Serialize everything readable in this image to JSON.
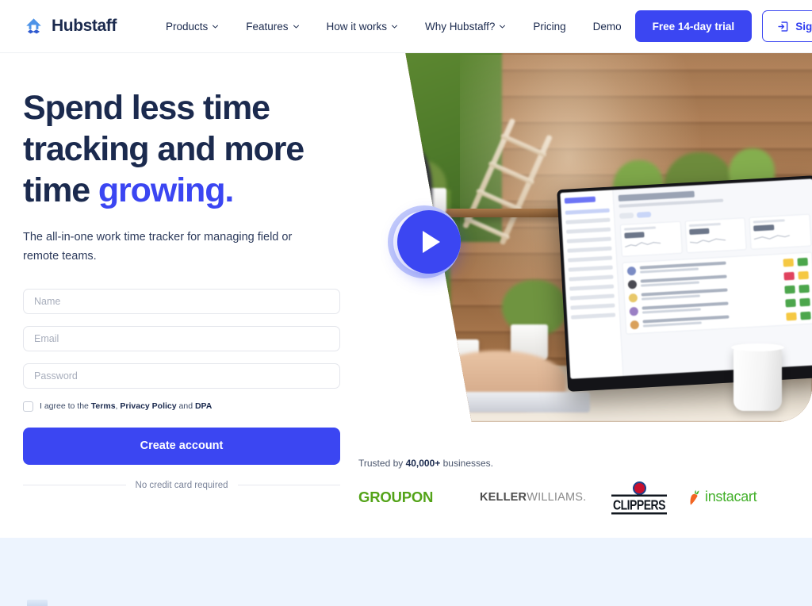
{
  "brand": {
    "name": "Hubstaff",
    "logo_icon": "hubstaff-logo-icon"
  },
  "colors": {
    "primary_blue": "#3b46f2",
    "headline_navy": "#1b2a4e",
    "groupon_green": "#53a318",
    "instacart_green": "#43b02a",
    "carrot_orange": "#f26522",
    "band_background": "#edf4fe"
  },
  "nav": {
    "items": [
      {
        "label": "Products",
        "has_dropdown": true,
        "icon": "chevron-down-icon"
      },
      {
        "label": "Features",
        "has_dropdown": true,
        "icon": "chevron-down-icon"
      },
      {
        "label": "How it works",
        "has_dropdown": true,
        "icon": "chevron-down-icon"
      },
      {
        "label": "Why Hubstaff?",
        "has_dropdown": true,
        "icon": "chevron-down-icon"
      },
      {
        "label": "Pricing",
        "has_dropdown": false,
        "icon": ""
      },
      {
        "label": "Demo",
        "has_dropdown": false,
        "icon": ""
      }
    ],
    "trial_button": "Free 14-day trial",
    "signin_button": "Sign in",
    "signin_icon": "sign-in-arrow-icon"
  },
  "hero": {
    "headline_part1": "Spend less time tracking and more time ",
    "headline_accent": "growing.",
    "subhead": "The all-in-one work time tracker for managing field or remote teams.",
    "play_icon": "play-button-icon"
  },
  "signup_form": {
    "name_placeholder": "Name",
    "name_value": "",
    "email_placeholder": "Email",
    "email_value": "",
    "password_placeholder": "Password",
    "password_value": "",
    "agree_prefix": "I agree to the ",
    "agree_terms": "Terms",
    "agree_sep1": ", ",
    "agree_privacy": "Privacy Policy",
    "agree_sep2": " and ",
    "agree_dpa": "DPA",
    "checkbox_checked": false,
    "submit_label": "Create account",
    "footnote": "No credit card required"
  },
  "trusted": {
    "prefix": "Trusted by ",
    "count": "40,000+",
    "suffix": " businesses.",
    "logos": [
      {
        "name": "GROUPON",
        "icon": "groupon-logo-icon"
      },
      {
        "name_bold": "KELLER",
        "name_light": "WILLIAMS.",
        "icon": "keller-williams-logo-icon"
      },
      {
        "name": "CLIPPERS",
        "icon": "clippers-logo-icon"
      },
      {
        "name": "instacart",
        "icon": "instacart-logo-icon"
      }
    ]
  }
}
